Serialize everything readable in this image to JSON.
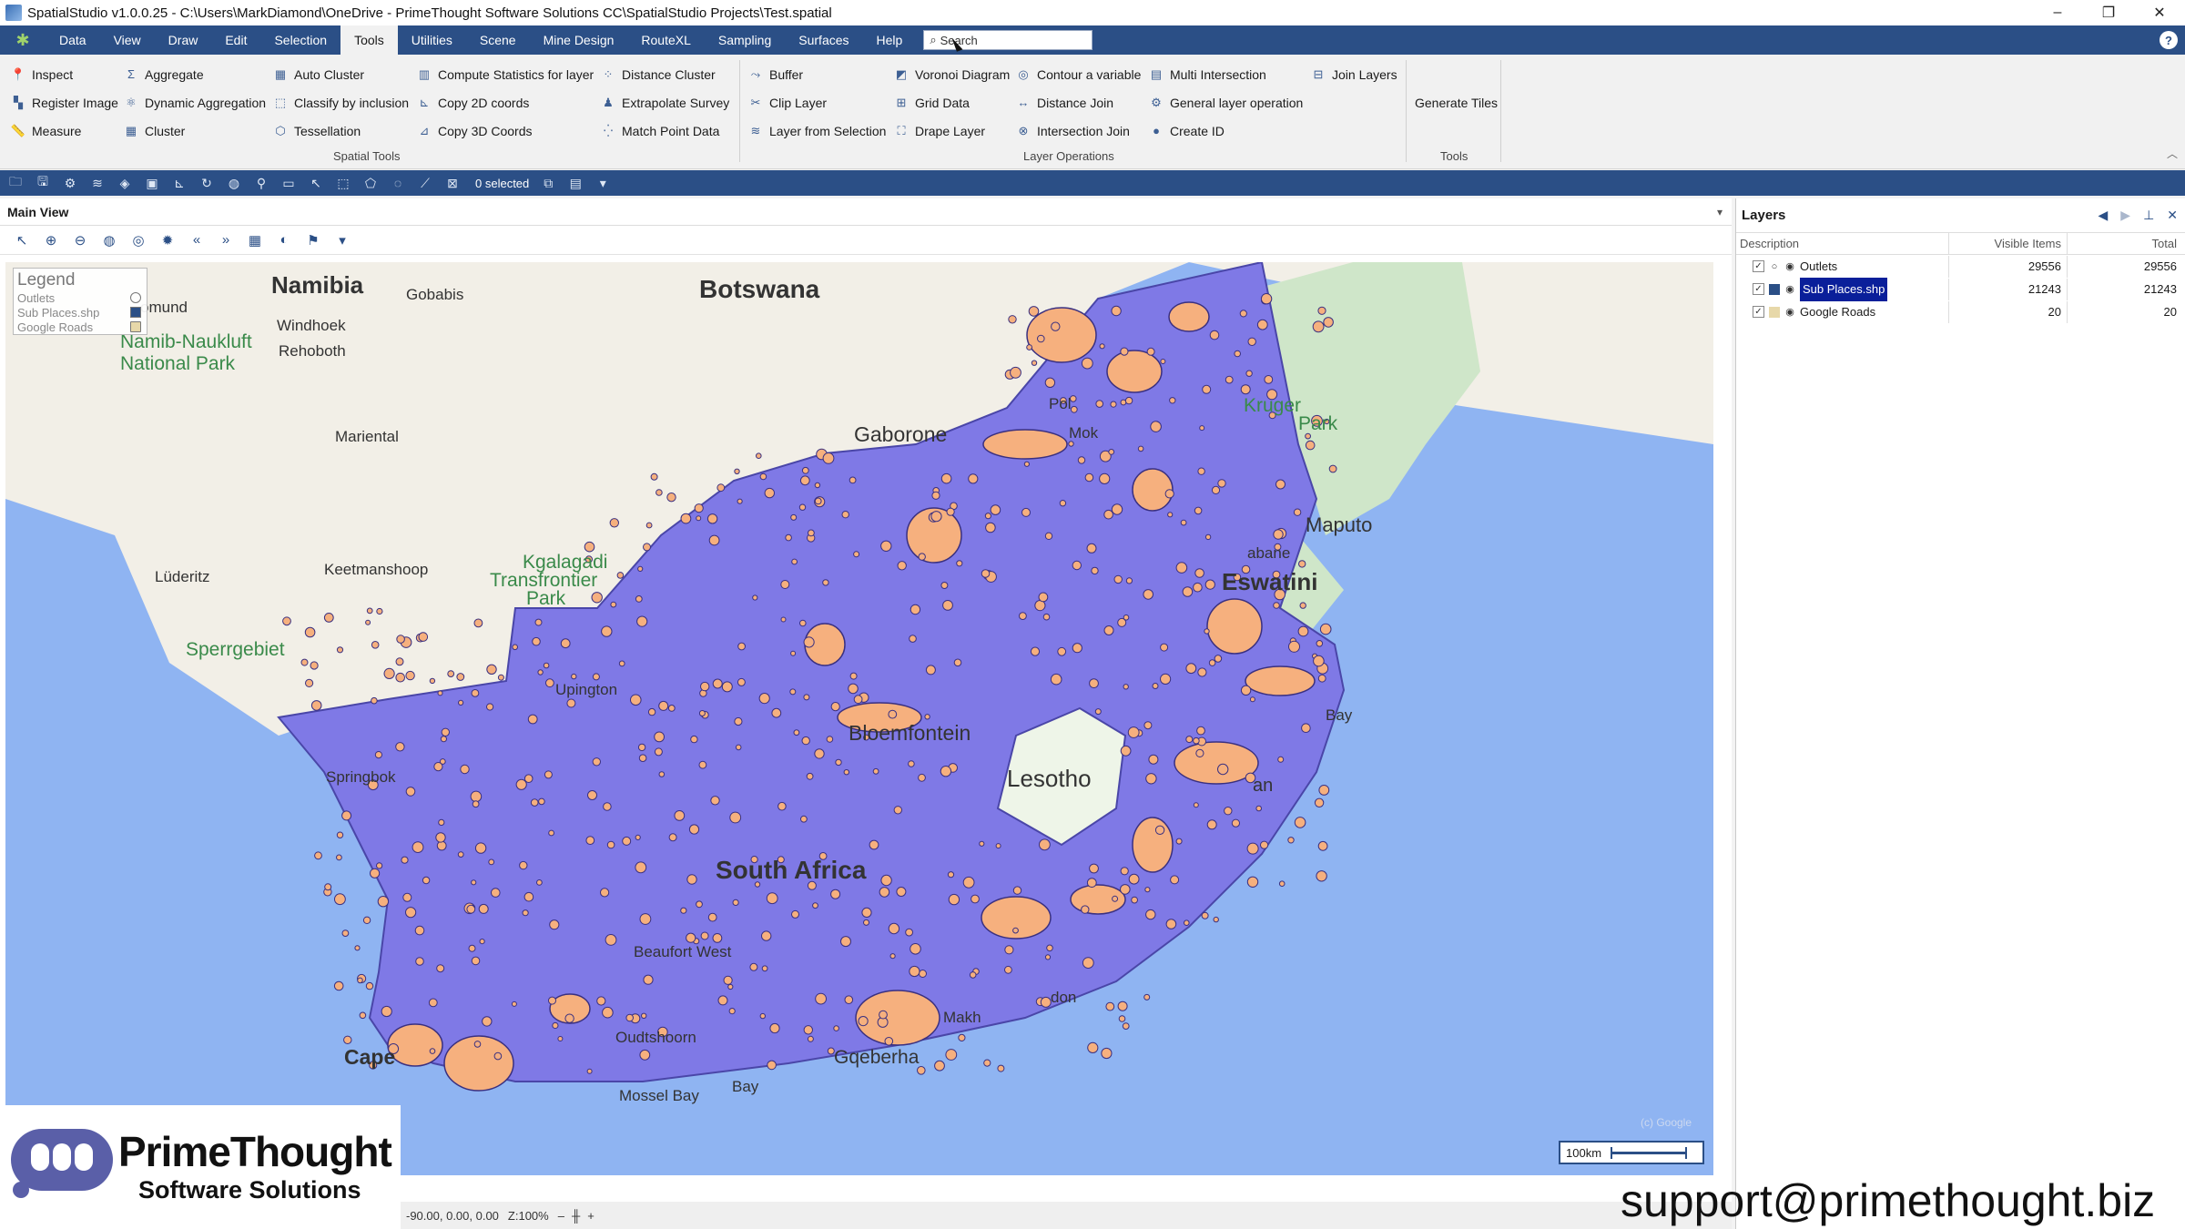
{
  "window": {
    "title": "SpatialStudio v1.0.0.25 - C:\\Users\\MarkDiamond\\OneDrive - PrimeThought Software Solutions CC\\SpatialStudio Projects\\Test.spatial",
    "minimize": "–",
    "maximize": "❐",
    "close": "✕"
  },
  "menu": {
    "items": [
      "Data",
      "View",
      "Draw",
      "Edit",
      "Selection",
      "Tools",
      "Utilities",
      "Scene",
      "Mine Design",
      "RouteXL",
      "Sampling",
      "Surfaces",
      "Help"
    ],
    "active": "Tools",
    "search_placeholder": "Search",
    "help": "?"
  },
  "ribbon": {
    "spatial_tools": {
      "label": "Spatial Tools",
      "col1": [
        "Inspect",
        "Register Image",
        "Measure"
      ],
      "col2": [
        "Aggregate",
        "Dynamic Aggregation",
        "Cluster"
      ],
      "col3": [
        "Auto Cluster",
        "Classify by inclusion",
        "Tessellation"
      ],
      "col4": [
        "Compute Statistics for layer",
        "Copy 2D coords",
        "Copy 3D Coords"
      ],
      "col5": [
        "Distance Cluster",
        "Extrapolate Survey",
        "Match Point Data"
      ]
    },
    "layer_operations": {
      "label": "Layer Operations",
      "col1": [
        "Buffer",
        "Clip Layer",
        "Layer from Selection"
      ],
      "col2": [
        "Voronoi Diagram",
        "Grid Data",
        "Drape Layer"
      ],
      "col3": [
        "Contour a variable",
        "Distance Join",
        "Intersection Join"
      ],
      "col4": [
        "Multi Intersection",
        "General layer operation",
        "Create ID"
      ],
      "col5": [
        "Join Layers"
      ]
    },
    "tools": {
      "label": "Tools",
      "col1": [
        "Generate Tiles"
      ]
    },
    "collapse": "︿"
  },
  "quickbar": {
    "selected": "0 selected"
  },
  "main_view": {
    "tab": "Main View"
  },
  "map": {
    "labels": {
      "namibia": "Namibia",
      "gobabis": "Gobabis",
      "botswana": "Botswana",
      "omund": "omund",
      "windhoek": "Windhoek",
      "namib": "Namib-Naukluft",
      "national_park": "National Park",
      "rehoboth": "Rehoboth",
      "gaborone": "Gaborone",
      "mariental": "Mariental",
      "kruger": "Kruger",
      "park": "Park",
      "maputo": "Maputo",
      "mok": "Mok",
      "pol": "Pol",
      "kgalagadi": "Kgalagadi",
      "transfrontier": "Transfrontier",
      "park2": "Park",
      "keetmanshoop": "Keetmanshoop",
      "luderitz": "Lüderitz",
      "mbabane": "abane",
      "eswatini": "Eswatini",
      "sperrgebiet": "Sperrgebiet",
      "upington": "Upington",
      "bloemfontein": "Bloemfontein",
      "bay": "Bay",
      "springbok": "Springbok",
      "lesotho": "Lesotho",
      "durban": "an",
      "south_africa": "South Africa",
      "beaufort_west": "Beaufort West",
      "oudtshoorn": "Oudtshoorn",
      "gqeberha": "Gqeberha",
      "mossel_bay": "Mossel Bay",
      "cape": "Cape",
      "east_london": "don",
      "bay2": "Bay",
      "makh": "Makh"
    },
    "copyright": "(c) Google",
    "scale": "100km"
  },
  "legend": {
    "title": "Legend",
    "items": [
      "Outlets",
      "Sub Places.shp",
      "Google Roads"
    ]
  },
  "layers": {
    "title": "Layers",
    "columns": [
      "Description",
      "Visible Items",
      "Total"
    ],
    "rows": [
      {
        "name": "Outlets",
        "visible": "29556",
        "total": "29556"
      },
      {
        "name": "Sub Places.shp",
        "visible": "21243",
        "total": "21243"
      },
      {
        "name": "Google Roads",
        "visible": "20",
        "total": "20"
      }
    ],
    "selected_row": "Sub Places.shp"
  },
  "status": {
    "coords": "-90.00, 0.00, 0.00",
    "zoom": "Z:100%"
  },
  "logo": {
    "name": "PrimeThought",
    "sub": "Software Solutions"
  },
  "support": "support@primethought.biz",
  "colors": {
    "accent": "#2b4f86",
    "subplaces_fill": "#7f79e6",
    "outlets_fill": "#f6b07e",
    "ocean": "#8fb4f2",
    "land": "#f2efe7",
    "selection": "#0a1f9a"
  }
}
